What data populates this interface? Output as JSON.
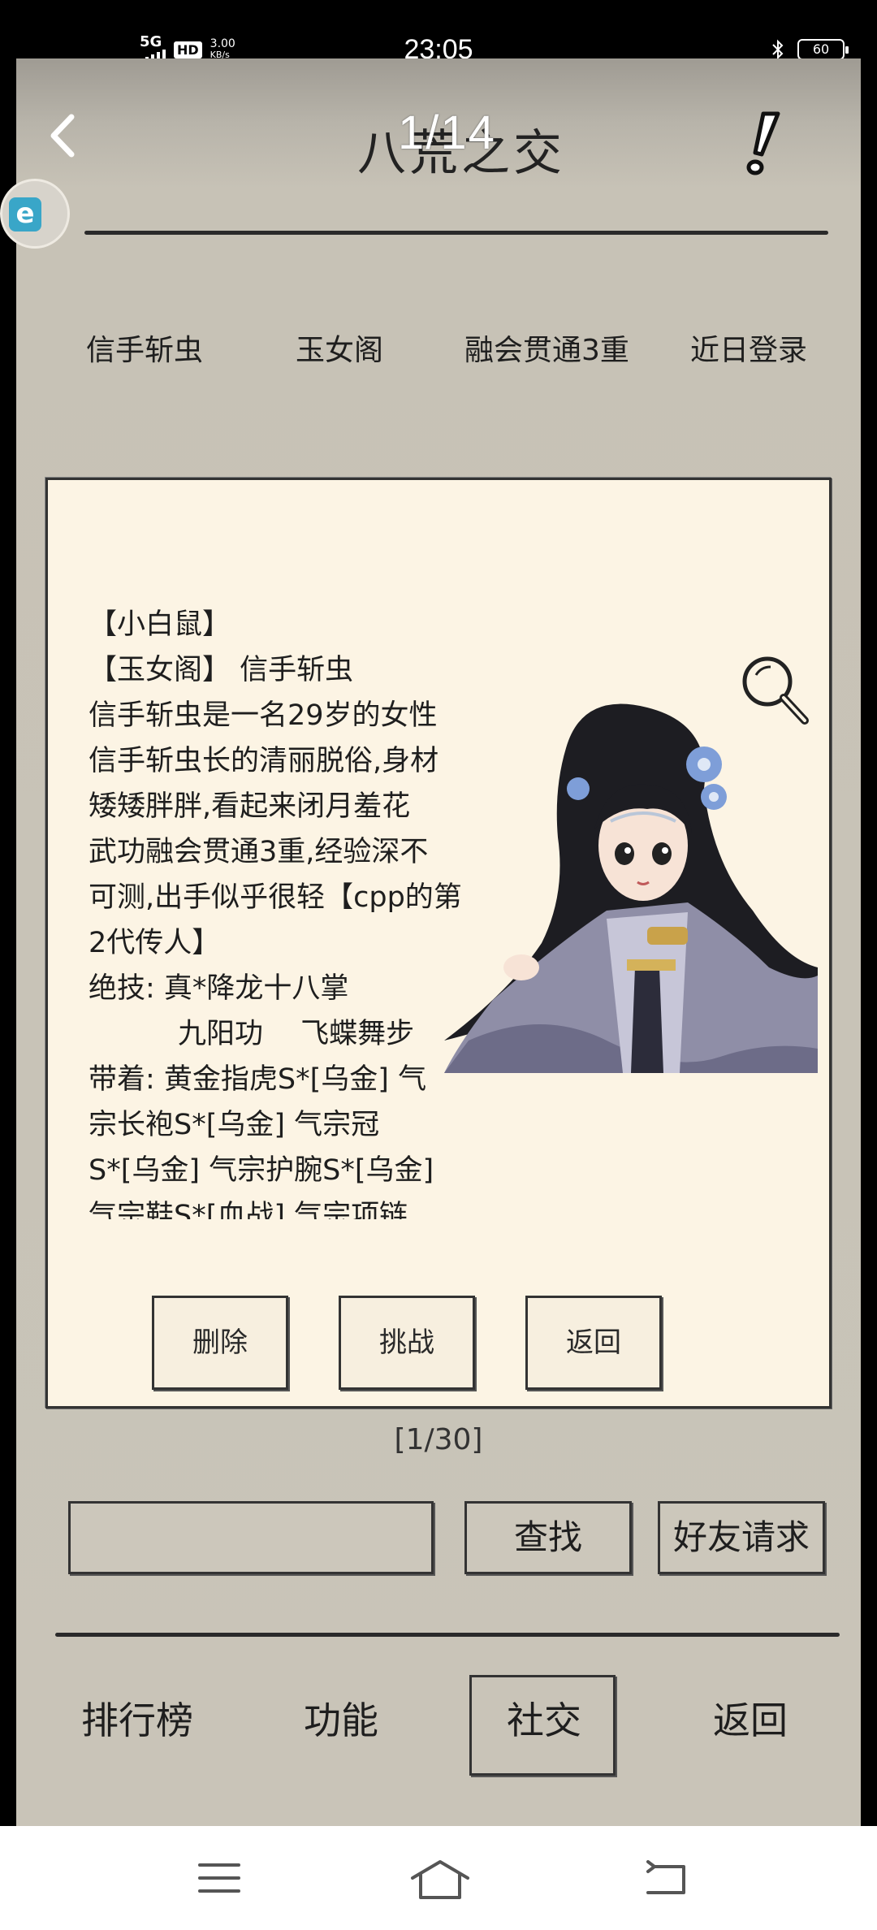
{
  "status_bar": {
    "network": "5G",
    "hd": "HD",
    "speed_value": "3.00",
    "speed_unit": "KB/s",
    "time": "23:05",
    "battery": "60"
  },
  "header": {
    "title": "八荒之交",
    "page_indicator": "1/14",
    "back_icon": "chevron-left-icon",
    "alert_icon": "exclamation-icon"
  },
  "player_info": {
    "name": "信手斩虫",
    "sect": "玉女阁",
    "level": "融会贯通3重",
    "login_status": "近日登录"
  },
  "profile": {
    "lines": [
      "【小白鼠】",
      "【玉女阁】 信手斩虫",
      "信手斩虫是一名29岁的女性",
      "信手斩虫长的清丽脱俗,身材",
      "矮矮胖胖,看起来闭月羞花",
      "武功融会贯通3重,经验深不",
      "可测,出手似乎很轻【cpp的第",
      "2代传人】",
      "绝技: 真*降龙十八掌",
      "九阳功　 飞蝶舞步",
      "带着: 黄金指虎S*[乌金] 气",
      "宗长袍S*[乌金] 气宗冠",
      "S*[乌金] 气宗护腕S*[乌金]",
      "气宗鞋S*[血战] 气宗项链"
    ],
    "search_icon": "magnifier-icon"
  },
  "card_buttons": {
    "delete": "删除",
    "challenge": "挑战",
    "back": "返回"
  },
  "pagination": "[1/30]",
  "search": {
    "value": "",
    "find_label": "查找",
    "friend_request_label": "好友请求"
  },
  "bottom_nav": {
    "ranking": "排行榜",
    "functions": "功能",
    "social": "社交",
    "back": "返回",
    "active": "社交"
  },
  "colors": {
    "background": "#c9c4b8",
    "card": "#fcf4e4",
    "ink": "#1e1e1e"
  }
}
